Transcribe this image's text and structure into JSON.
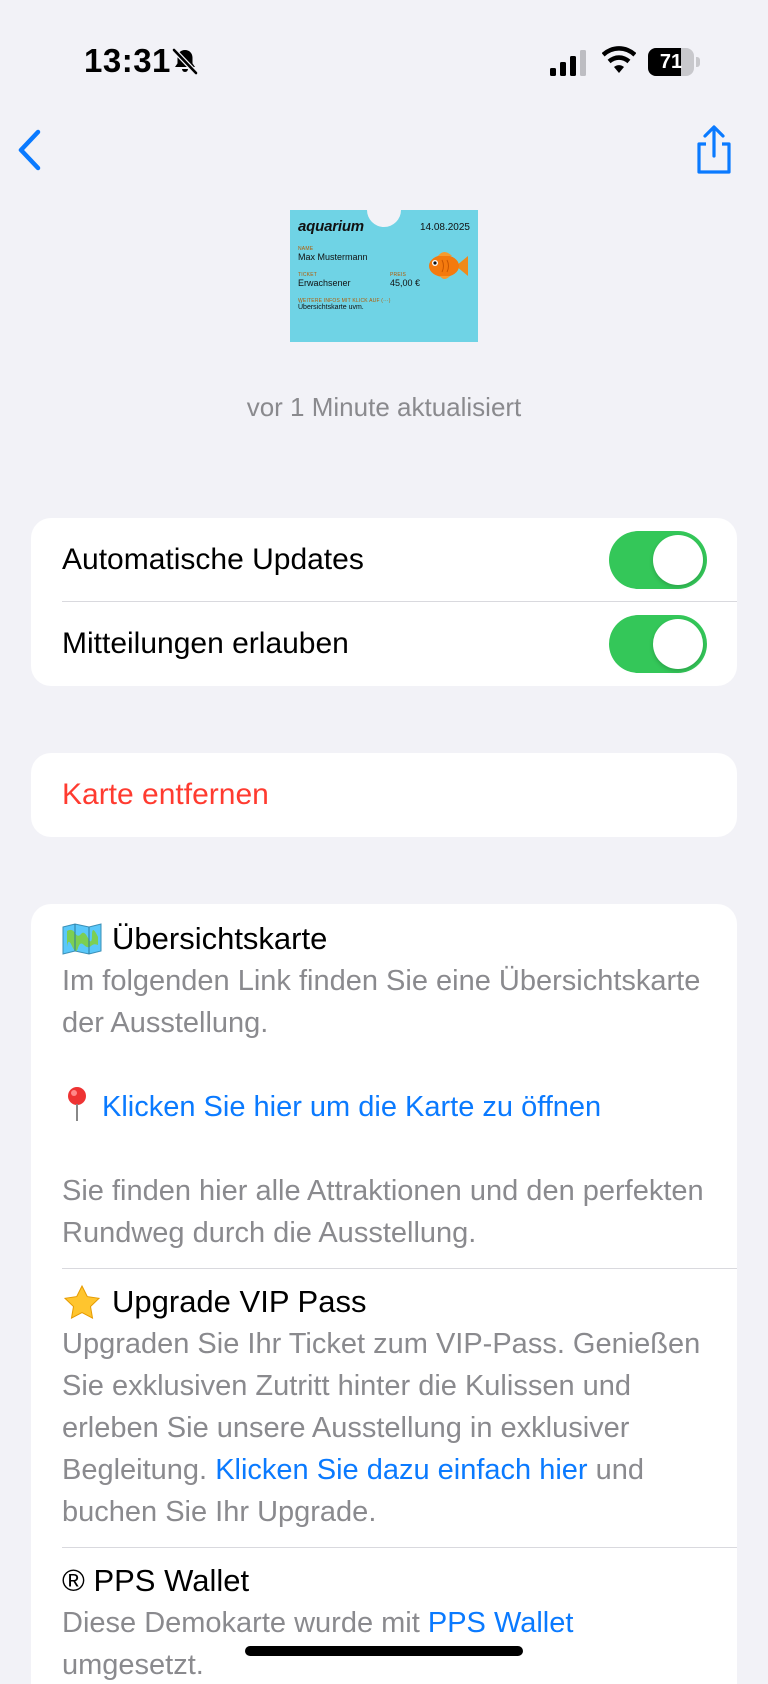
{
  "status_bar": {
    "time": "13:31",
    "battery": "71",
    "battery_level": 0.71
  },
  "ticket": {
    "brand": "aquarium",
    "date": "14.08.2025",
    "name_label": "NAME",
    "name": "Max Mustermann",
    "ticket_label": "TICKET",
    "ticket_type": "Erwachsener",
    "price_label": "PREIS",
    "price": "45,00 €",
    "info_label": "WEITERE INFOS MIT KLICK AUF (···)",
    "info_text": "Übersichtskarte uvm."
  },
  "updated_text": "vor 1 Minute aktualisiert",
  "settings": {
    "auto_updates_label": "Automatische Updates",
    "auto_updates_on": true,
    "notifications_label": "Mitteilungen erlauben",
    "notifications_on": true
  },
  "remove_card_label": "Karte entfernen",
  "fields": {
    "map": {
      "title": "Übersichtskarte",
      "text1": "Im folgenden Link finden Sie eine Übersichtskarte der Ausstellung.",
      "link": "Klicken Sie hier um die Karte zu öffnen",
      "text2": "Sie finden hier alle Attraktionen und den perfekten Rundweg durch die Ausstellung."
    },
    "vip": {
      "title": "Upgrade VIP Pass",
      "text1": "Upgraden Sie Ihr Ticket zum VIP-Pass. Genießen Sie exklusiven Zutritt hinter die Kulissen und erleben Sie unsere Ausstellung in exklusiver Begleitung.",
      "link": "Klicken Sie dazu einfach hier",
      "text2": "und buchen Sie Ihr Upgrade."
    },
    "pps": {
      "title": "® PPS Wallet",
      "text1": "Diese Demokarte wurde mit",
      "link": "PPS Wallet",
      "text2": "umgesetzt."
    }
  },
  "colors": {
    "accent": "#0a7aff",
    "toggle_on": "#34c759",
    "danger": "#ff3b30",
    "background": "#f2f2f7"
  }
}
